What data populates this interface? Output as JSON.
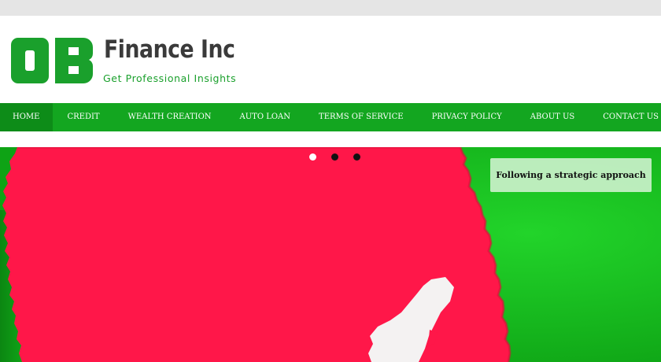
{
  "brand": {
    "logo_letters": "OB",
    "name": "Finance Inc",
    "tagline": "Get Professional Insights",
    "color_primary": "#1aa02c",
    "color_text": "#3a3a3a"
  },
  "nav": {
    "items": [
      {
        "label": "HOME",
        "active": true
      },
      {
        "label": "CREDIT"
      },
      {
        "label": "WEALTH CREATION"
      },
      {
        "label": "AUTO LOAN"
      },
      {
        "label": "TERMS OF SERVICE"
      },
      {
        "label": "PRIVACY POLICY"
      },
      {
        "label": "ABOUT US"
      },
      {
        "label": "CONTACT US"
      }
    ],
    "background": "#13a620",
    "active_background": "#0d8c18"
  },
  "slider": {
    "caption": "Following a strategic approach",
    "slide_count": 3,
    "active_slide": 1,
    "colors": {
      "red": "#ff1749",
      "green": "#12b91b"
    }
  }
}
